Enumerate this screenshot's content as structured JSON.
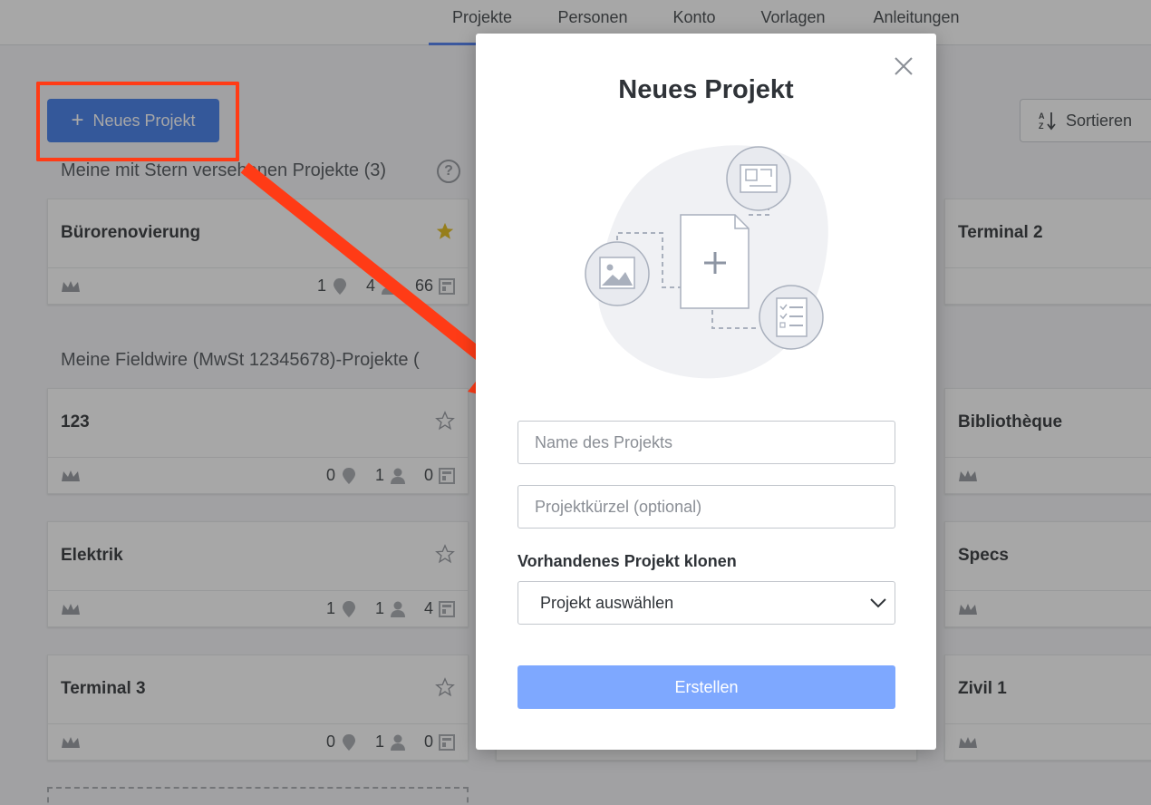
{
  "nav": {
    "tabs": [
      {
        "label": "Projekte"
      },
      {
        "label": "Personen"
      },
      {
        "label": "Konto"
      },
      {
        "label": "Vorlagen"
      },
      {
        "label": "Anleitungen"
      }
    ],
    "active_tab": "Projekte"
  },
  "toolbar": {
    "new_project_label": "Neues Projekt",
    "sort_label": "Sortieren"
  },
  "sections": {
    "starred_title": "Meine mit Stern versehenen Projekte (3)",
    "account_title": "Meine Fieldwire (MwSt 12345678)-Projekte ("
  },
  "cards": [
    {
      "name": "Bürorenovierung",
      "starred": true,
      "tasks": "1",
      "people": "4",
      "plans": "66"
    },
    {
      "name": "Terminal 2",
      "starred": false
    },
    {
      "name": "123",
      "starred": false,
      "tasks": "0",
      "people": "1",
      "plans": "0"
    },
    {
      "name": "Bibliothèque",
      "starred": false
    },
    {
      "name": "Elektrik",
      "starred": false,
      "tasks": "1",
      "people": "1",
      "plans": "4"
    },
    {
      "name": "Specs",
      "starred": false
    },
    {
      "name": "Terminal 3",
      "starred": false,
      "tasks": "0",
      "people": "1",
      "plans": "0"
    },
    {
      "name": "Zivil 1",
      "starred": false
    }
  ],
  "modal": {
    "title": "Neues Projekt",
    "name_placeholder": "Name des Projekts",
    "code_placeholder": "Projektkürzel (optional)",
    "clone_label": "Vorhandenes Projekt klonen",
    "select_value": "Projekt auswählen",
    "create_label": "Erstellen"
  },
  "colors": {
    "primary": "#2f6fe8",
    "create_button": "#7ea8ff",
    "annotation": "#ff3b16",
    "star_active": "#e0b400"
  }
}
